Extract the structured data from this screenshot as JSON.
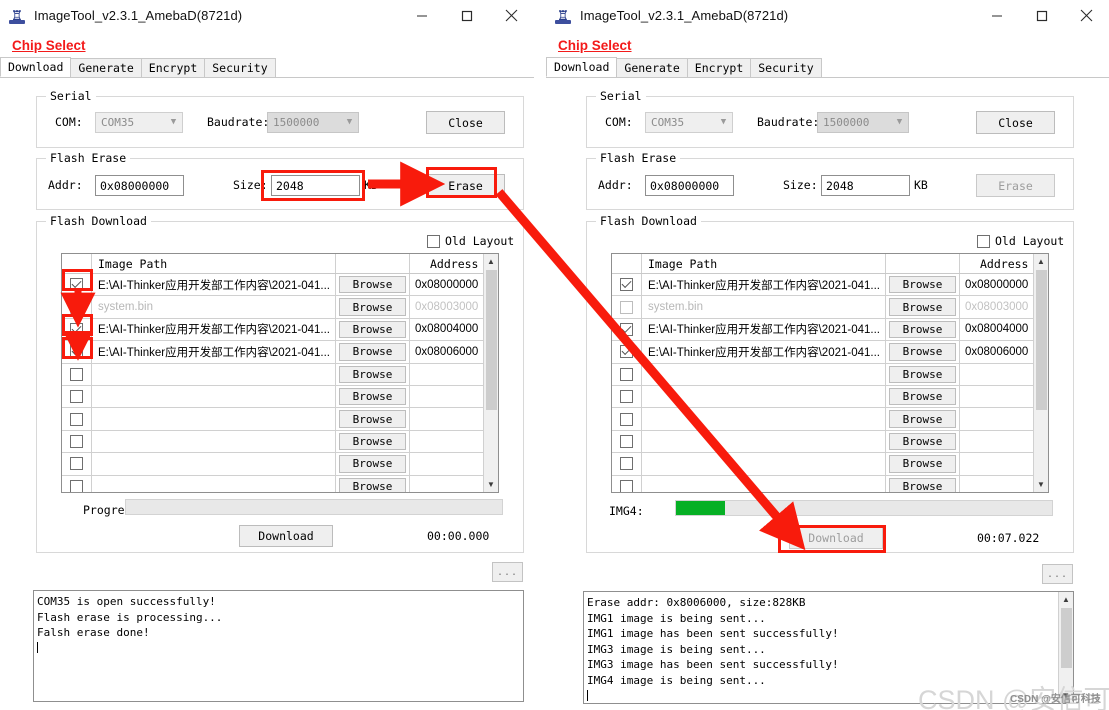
{
  "window": {
    "title": "ImageTool_v2.3.1_AmebaD(8721d)",
    "minimize_label": "minimize-icon",
    "maximize_label": "maximize-icon",
    "close_label": "close-icon"
  },
  "chip_select": {
    "label": "Chip Select"
  },
  "tabs": [
    {
      "label": "Download",
      "active": true
    },
    {
      "label": "Generate",
      "active": false
    },
    {
      "label": "Encrypt",
      "active": false
    },
    {
      "label": "Security",
      "active": false
    }
  ],
  "serial": {
    "legend": "Serial",
    "com_label": "COM:",
    "com_value": "COM35",
    "baudrate_label": "Baudrate:",
    "baudrate_value": "1500000",
    "close_button": "Close"
  },
  "flash_erase": {
    "legend": "Flash Erase",
    "addr_label": "Addr:",
    "addr_value": "0x08000000",
    "size_label": "Size:",
    "size_value": "2048",
    "size_unit": "KB",
    "erase_button": "Erase"
  },
  "flash_download": {
    "legend": "Flash Download",
    "old_layout_label": "Old Layout",
    "old_layout_checked": false,
    "columns": {
      "image_path": "Image Path",
      "address": "Address"
    },
    "browse_label": "Browse",
    "rows": [
      {
        "checked": true,
        "dimmed": false,
        "path": "E:\\AI-Thinker应用开发部工作内容\\2021-041...",
        "address": "0x08000000"
      },
      {
        "checked": false,
        "dimmed": true,
        "path": "system.bin",
        "address": "0x08003000"
      },
      {
        "checked": true,
        "dimmed": false,
        "path": "E:\\AI-Thinker应用开发部工作内容\\2021-041...",
        "address": "0x08004000"
      },
      {
        "checked": true,
        "dimmed": false,
        "path": "E:\\AI-Thinker应用开发部工作内容\\2021-041...",
        "address": "0x08006000"
      },
      {
        "checked": false,
        "dimmed": false,
        "path": "",
        "address": ""
      },
      {
        "checked": false,
        "dimmed": false,
        "path": "",
        "address": ""
      },
      {
        "checked": false,
        "dimmed": false,
        "path": "",
        "address": ""
      },
      {
        "checked": false,
        "dimmed": false,
        "path": "",
        "address": ""
      },
      {
        "checked": false,
        "dimmed": false,
        "path": "",
        "address": ""
      },
      {
        "checked": false,
        "dimmed": false,
        "path": "",
        "address": ""
      }
    ]
  },
  "left_panel": {
    "progress_label": "Progress:",
    "progress_percent": 0,
    "download_button": "Download",
    "elapsed": "00:00.000",
    "dots_button": "...",
    "log_lines": [
      "COM35 is open successfully!",
      "Flash erase is processing...",
      "Falsh erase done!"
    ]
  },
  "right_panel": {
    "progress_label": "IMG4:",
    "progress_percent": 13,
    "progress_color": "#06b025",
    "download_button": "Download",
    "elapsed": "00:07.022",
    "dots_button": "...",
    "log_lines": [
      "Erase addr: 0x8006000, size:828KB",
      "IMG1 image is being sent...",
      "IMG1 image has been sent successfully!",
      "IMG3 image is being sent...",
      "IMG3 image has been sent successfully!",
      "IMG4 image is being sent..."
    ]
  },
  "annotations": {
    "accent_color": "#f81b0c",
    "watermark": "CSDN @安信可科技",
    "watermark_small": "CSDN @安信可科技"
  }
}
